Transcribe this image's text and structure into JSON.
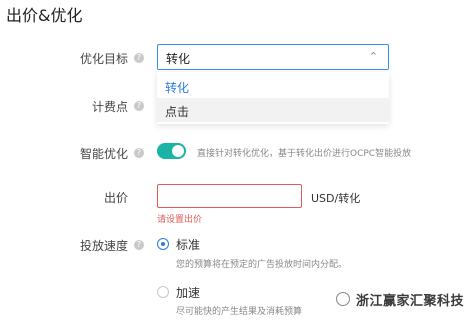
{
  "section_title": "出价&优化",
  "optimization": {
    "label": "优化目标",
    "selected": "转化",
    "options": [
      "转化",
      "点击"
    ]
  },
  "billing": {
    "label": "计费点"
  },
  "smart": {
    "label": "智能优化",
    "enabled": true,
    "hint": "直接针对转化优化，基于转化出价进行OCPC智能投放"
  },
  "bid": {
    "label": "出价",
    "value": "",
    "unit": "USD/转化",
    "error": "请设置出价"
  },
  "pacing": {
    "label": "投放速度",
    "options": [
      {
        "label": "标准",
        "desc": "您的预算将在预定的广告投放时间内分配。",
        "selected": true
      },
      {
        "label": "加速",
        "desc": "尽可能快的产生结果及消耗预算",
        "selected": false
      }
    ]
  },
  "watermark": "浙江赢家汇聚科技",
  "colors": {
    "accent": "#2d7bd8",
    "toggle": "#1ab3a6",
    "error": "#e05a5a"
  }
}
